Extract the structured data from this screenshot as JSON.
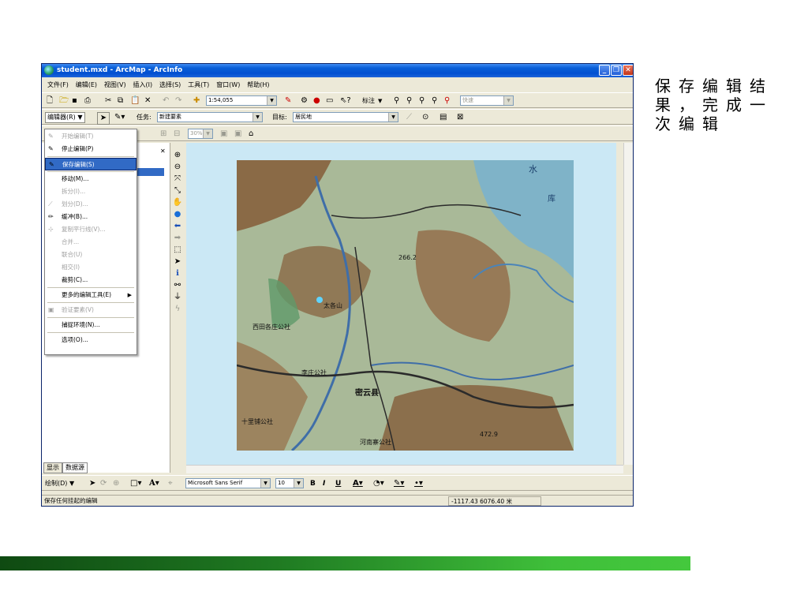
{
  "window": {
    "title": "student.mxd - ArcMap - ArcInfo",
    "controls": [
      "_",
      "❐",
      "✕"
    ]
  },
  "menubar": [
    "文件(F)",
    "编辑(E)",
    "视图(V)",
    "插入(I)",
    "选择(S)",
    "工具(T)",
    "窗口(W)",
    "帮助(H)"
  ],
  "toolbar_standard": {
    "scale": "1:54,055",
    "label_menu": "标注",
    "quick_field": "快速"
  },
  "toolbar_editor": {
    "editor_menu": "编辑器(R)",
    "task_label": "任务:",
    "task_value": "新建要素",
    "target_label": "目标:",
    "target_value": "居民地"
  },
  "toolbar_view": {
    "zoom": "30%"
  },
  "editor_menu": {
    "items": [
      {
        "label": "开始编辑(T)",
        "enabled": false,
        "icon": "pencil-icon"
      },
      {
        "label": "停止编辑(P)",
        "enabled": true,
        "icon": "stop-edit-icon"
      },
      {
        "label": "保存编辑(S)",
        "enabled": true,
        "highlighted": true,
        "icon": "save-edits-icon"
      },
      {
        "label": "移动(M)...",
        "enabled": true
      },
      {
        "label": "拆分(I)...",
        "enabled": false
      },
      {
        "label": "划分(D)...",
        "enabled": false,
        "icon": "divide-icon"
      },
      {
        "label": "缓冲(B)...",
        "enabled": true,
        "icon": "buffer-icon"
      },
      {
        "label": "复制平行线(V)...",
        "enabled": false,
        "icon": "copy-parallel-icon"
      },
      {
        "label": "合并...",
        "enabled": false
      },
      {
        "label": "联合(U)",
        "enabled": false
      },
      {
        "label": "相交(I)",
        "enabled": false
      },
      {
        "label": "裁剪(C)...",
        "enabled": true
      },
      {
        "label": "更多的编辑工具(E)",
        "enabled": true,
        "submenu": true
      },
      {
        "label": "验证要素(V)",
        "enabled": false,
        "icon": "validate-icon"
      },
      {
        "label": "捕捉环境(N)...",
        "enabled": true
      },
      {
        "label": "选项(O)...",
        "enabled": true
      }
    ]
  },
  "toc": {
    "tabs": [
      "显示",
      "数据源"
    ]
  },
  "map_labels": {
    "water": "水",
    "dam": "库",
    "height1": "266.2",
    "town1": "西田各庄公社",
    "town2": "密云县",
    "town3": "十里铺公社",
    "town4": "李庄公社",
    "town5": "太各山",
    "town6": "河南寨公社",
    "height2": "472.9"
  },
  "drawing_toolbar": {
    "draw_menu": "绘制(D)",
    "font_name": "Microsoft Sans Serif",
    "font_size": "10",
    "bold": "B",
    "italic": "I",
    "underline": "U"
  },
  "status": {
    "message": "保存任何挂起的编辑",
    "coordinates": "-1117.43  6076.40 米"
  },
  "slide_note": "保存编辑结果，完成一次编辑",
  "colors": {
    "title_bar": "#0a5fd8",
    "map_background": "#cbe8f5",
    "highlight": "#316ac5",
    "footer_bar": "#3fbf3a"
  }
}
